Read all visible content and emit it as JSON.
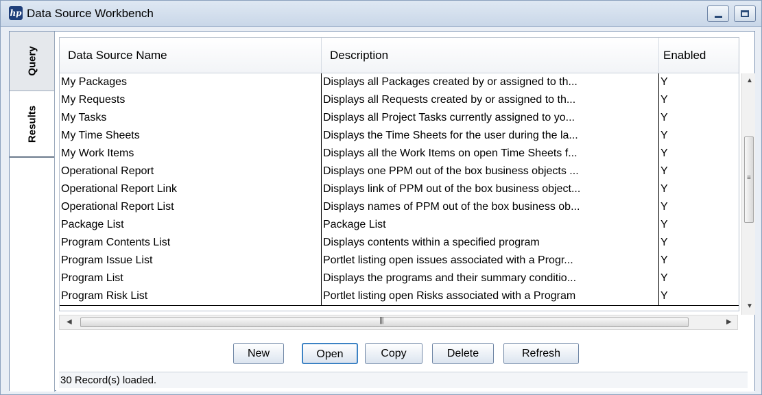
{
  "window": {
    "title": "Data Source Workbench"
  },
  "tabs": [
    {
      "label": "Query"
    },
    {
      "label": "Results"
    }
  ],
  "table": {
    "columns": [
      "Data Source Name",
      "Description",
      "Enabled"
    ],
    "rows": [
      {
        "name": "My Packages",
        "description": "Displays all Packages created by or assigned to th...",
        "enabled": "Y"
      },
      {
        "name": "My Requests",
        "description": "Displays all Requests created by or assigned to th...",
        "enabled": "Y"
      },
      {
        "name": "My Tasks",
        "description": "Displays all Project Tasks currently assigned to yo...",
        "enabled": "Y"
      },
      {
        "name": "My Time Sheets",
        "description": "Displays the Time Sheets for the user during the la...",
        "enabled": "Y"
      },
      {
        "name": "My Work Items",
        "description": "Displays all the Work Items on open Time Sheets f...",
        "enabled": "Y"
      },
      {
        "name": "Operational Report",
        "description": "Displays one PPM out of the box business objects ...",
        "enabled": "Y"
      },
      {
        "name": "Operational Report Link",
        "description": "Displays link of PPM out of the box business object...",
        "enabled": "Y"
      },
      {
        "name": "Operational Report List",
        "description": "Displays names of PPM out of the box business ob...",
        "enabled": "Y"
      },
      {
        "name": "Package List",
        "description": "Package List",
        "enabled": "Y"
      },
      {
        "name": "Program Contents List",
        "description": "Displays contents within a specified program",
        "enabled": "Y"
      },
      {
        "name": "Program Issue List",
        "description": "Portlet listing open issues associated with a Progr...",
        "enabled": "Y"
      },
      {
        "name": "Program List",
        "description": "Displays the programs and their summary conditio...",
        "enabled": "Y"
      },
      {
        "name": "Program Risk List",
        "description": "Portlet listing open Risks associated with a Program",
        "enabled": "Y"
      }
    ]
  },
  "buttons": {
    "new": "New",
    "open": "Open",
    "copy": "Copy",
    "delete": "Delete",
    "refresh": "Refresh"
  },
  "status": "30 Record(s) loaded.",
  "icons": {
    "app": "app-logo-icon",
    "minimize": "minimize-icon",
    "maximize": "maximize-icon"
  },
  "colors": {
    "title_bar": "#c9d7e8",
    "focus_border": "#3c82c4"
  }
}
